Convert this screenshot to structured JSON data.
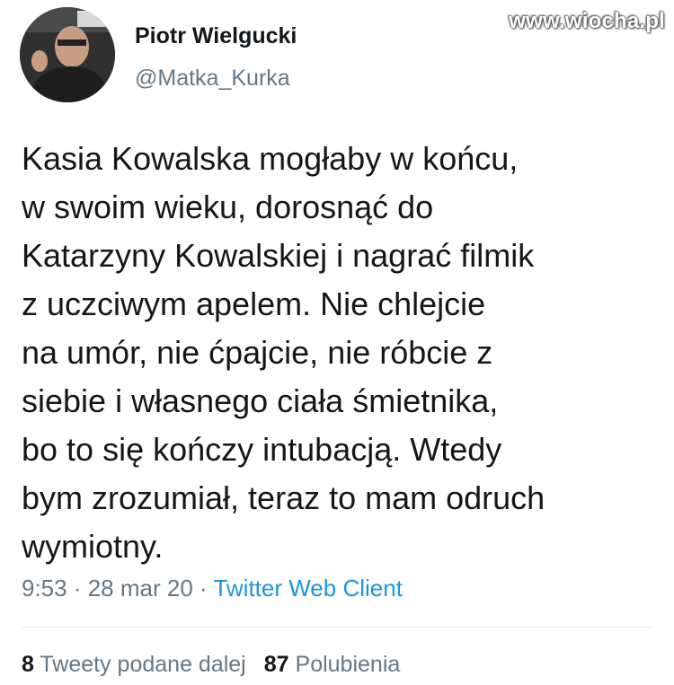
{
  "watermark": "www.wiocha.pl",
  "author": {
    "name": "Piotr Wielgucki",
    "handle": "@Matka_Kurka"
  },
  "tweet": {
    "text": "Kasia Kowalska mogłaby w końcu,\nw swoim wieku, dorosnąć do\nKatarzyny Kowalskiej i nagrać filmik\nz uczciwym apelem. Nie chlejcie\nna umór, nie ćpajcie, nie róbcie z\nsiebie i własnego ciała śmietnika,\nbo to się kończy intubacją. Wtedy\nbym zrozumiał, teraz to mam odruch\nwymiotny."
  },
  "meta": {
    "time": "9:53",
    "separator1": " · ",
    "date": "28 mar 20",
    "separator2": " · ",
    "client": "Twitter Web Client"
  },
  "stats": {
    "retweets_count": "8",
    "retweets_label": "Tweety podane dalej",
    "likes_count": "87",
    "likes_label": "Polubienia"
  },
  "colors": {
    "text": "#14171a",
    "secondary": "#657786",
    "link": "#1b95e0",
    "divider": "#e6ecf0"
  }
}
